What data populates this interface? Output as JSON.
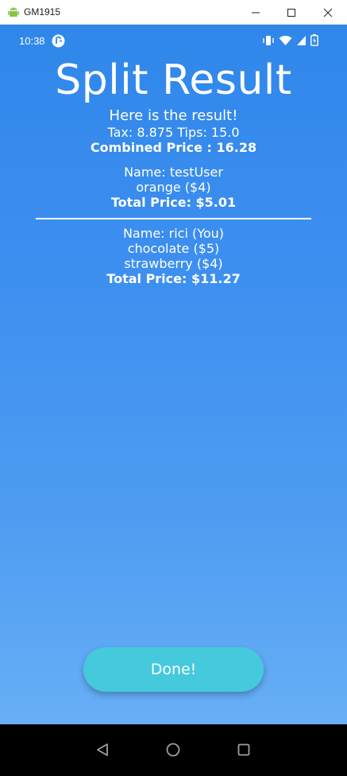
{
  "window": {
    "title": "GM1915",
    "icon": "android-icon",
    "controls": [
      "minimize-icon",
      "maximize-icon",
      "close-icon"
    ]
  },
  "status_bar": {
    "time": "10:38",
    "icons": [
      "sync-icon",
      "vibrate-icon",
      "wifi-icon",
      "signal-icon",
      "battery-icon"
    ]
  },
  "page": {
    "title": "Split Result",
    "intro": "Here is the result!",
    "tax_tips": "Tax: 8.875 Tips: 15.0",
    "combined_price": "Combined Price : 16.28"
  },
  "people": [
    {
      "name": "Name: testUser",
      "items": [
        "orange ($4)"
      ],
      "total": "Total Price: $5.01"
    },
    {
      "name": "Name: rici (You)",
      "items": [
        "chocolate ($5)",
        "strawberry ($4)"
      ],
      "total": "Total Price: $11.27"
    }
  ],
  "actions": {
    "done_label": "Done!"
  },
  "nav_bar": {
    "icons": [
      "back-icon",
      "home-icon",
      "recents-icon"
    ]
  },
  "colors": {
    "gradient_top": "#2f87ea",
    "gradient_bottom": "#67aef5",
    "button": "#45c9dd",
    "text": "#ffffff"
  }
}
